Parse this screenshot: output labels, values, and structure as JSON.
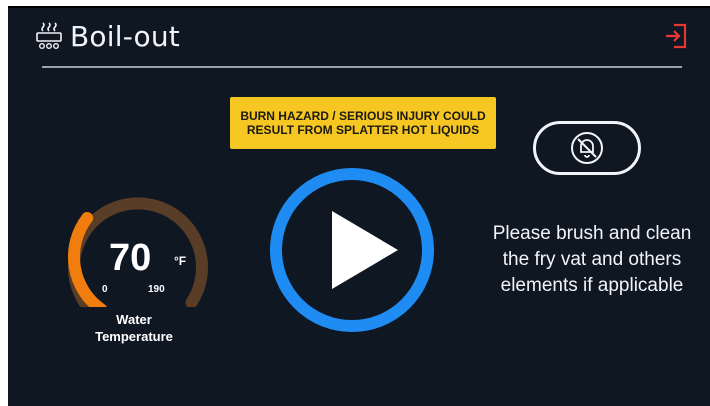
{
  "header": {
    "title": "Boil-out",
    "title_icon": "boil-icon",
    "exit_icon": "exit-icon"
  },
  "warning": {
    "line1": "BURN HAZARD / SERIOUS INJURY COULD",
    "line2": "RESULT FROM SPLATTER HOT LIQUIDS"
  },
  "mute_button": {
    "icon": "bell-slash-icon"
  },
  "water_temperature": {
    "value": "70",
    "unit": "°F",
    "min": "0",
    "max": "190",
    "level": 0.37,
    "label_line1": "Water",
    "label_line2": "Temperature"
  },
  "play_button": {
    "icon": "play-icon"
  },
  "instructions": {
    "line1": "Please brush and clean",
    "line2": "the fry vat and others",
    "line3": "elements if applicable"
  },
  "colors": {
    "background": "#0f1723",
    "accent_blue": "#1e8cf2",
    "gauge_active": "#f07d0e",
    "gauge_track": "#5a3d26",
    "warning_bg": "#f6c622",
    "exit_red": "#e53935"
  }
}
